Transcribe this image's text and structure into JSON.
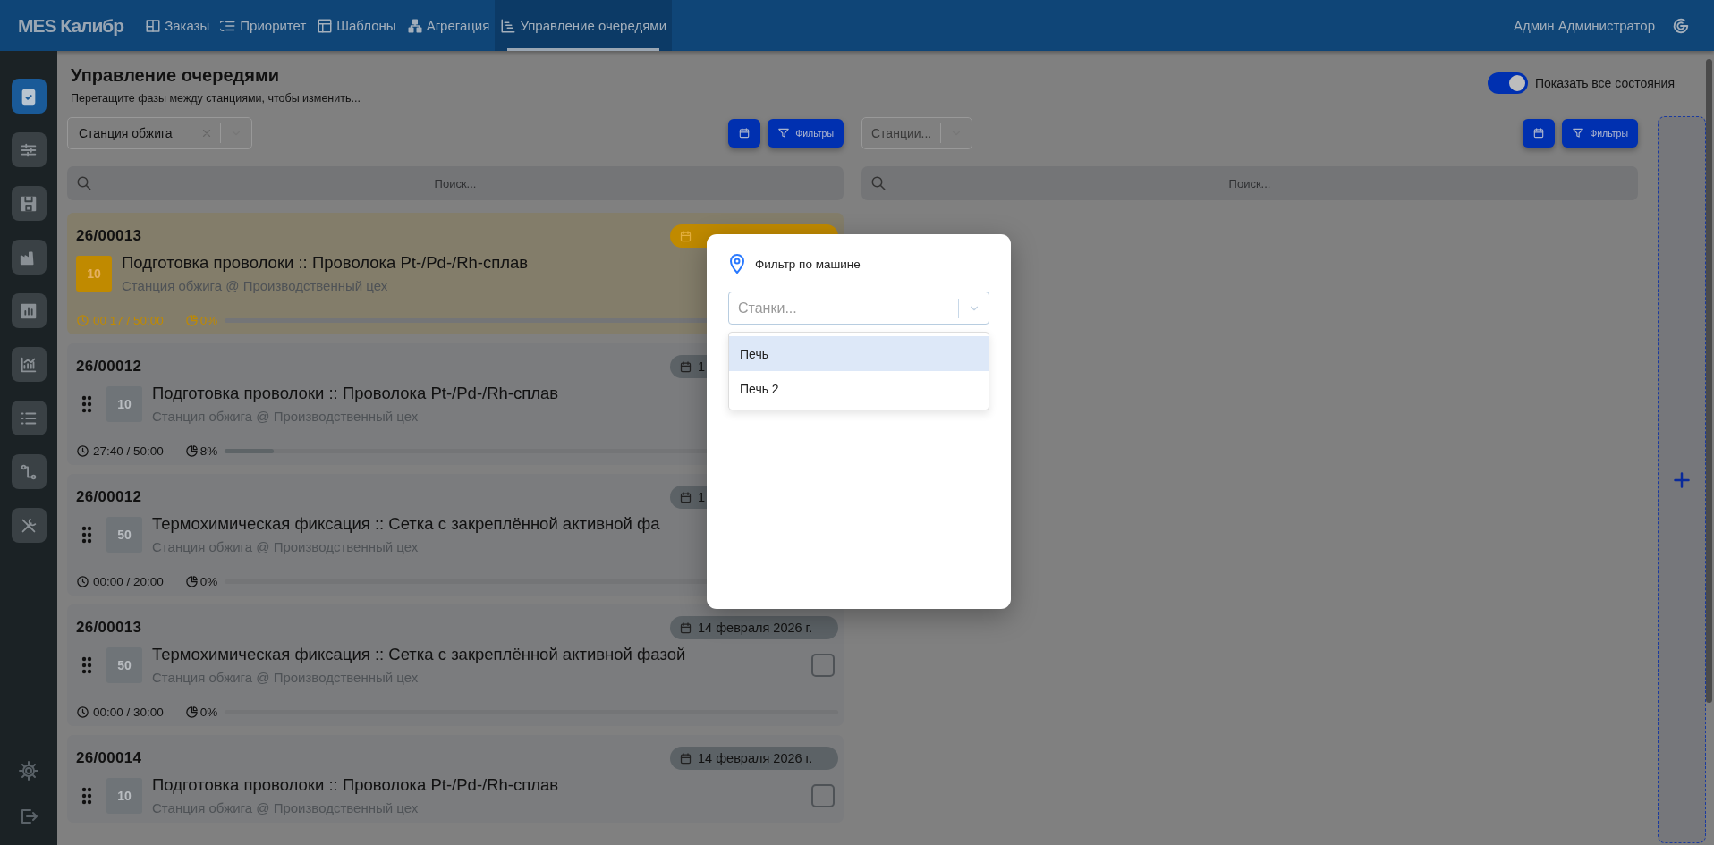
{
  "header": {
    "logo": "MES Калибр",
    "nav": [
      {
        "label": "Заказы",
        "selected": false
      },
      {
        "label": "Приоритет",
        "selected": false
      },
      {
        "label": "Шаблоны",
        "selected": false
      },
      {
        "label": "Агрегация",
        "selected": false
      },
      {
        "label": "Управление очередями",
        "selected": true
      }
    ],
    "user": "Админ Администратор"
  },
  "sidebar": {
    "items": [
      {
        "selected": true
      },
      {
        "selected": false
      },
      {
        "selected": false
      },
      {
        "selected": false
      },
      {
        "selected": false
      },
      {
        "selected": false
      },
      {
        "selected": false
      },
      {
        "selected": false
      },
      {
        "selected": false
      }
    ]
  },
  "page": {
    "title": "Управление очередями",
    "subtitle": "Перетащите фазы между станциями, чтобы изменить...",
    "toggle": {
      "label": "Показать все состояния",
      "on": true
    }
  },
  "columns": [
    {
      "station": {
        "value": "Станция обжига"
      },
      "filters_label": "Фильтры",
      "search_placeholder": "Поиск...",
      "cards": [
        {
          "order": "26/00013",
          "number": "10",
          "title": "Подготовка проволоки :: Проволока Pt-/Pd-/Rh-сплав",
          "location": "Станция обжига @ Производственный цех",
          "time": "00 17 / 50:00",
          "progress": "0%",
          "level": 0,
          "highlighted": true,
          "draggable": false
        },
        {
          "order": "26/00012",
          "date": "1",
          "number": "10",
          "title": "Подготовка проволоки :: Проволока Pt-/Pd-/Rh-сплав",
          "location": "Станция обжига @ Производственный цех",
          "time": "27:40 / 50:00",
          "progress": "8%",
          "level": 0.08,
          "highlighted": false,
          "draggable": true
        },
        {
          "order": "26/00012",
          "date": "1",
          "number": "50",
          "title": "Термохимическая фиксация :: Сетка с закреплённой активной фа",
          "location": "Станция обжига @ Производственный цех",
          "time": "00:00 / 20:00",
          "progress": "0%",
          "level": 0,
          "highlighted": false,
          "draggable": true
        },
        {
          "order": "26/00013",
          "date": "14 февраля 2026 г.",
          "number": "50",
          "title": "Термохимическая фиксация :: Сетка с закреплённой активной фазой",
          "location": "Станция обжига @ Производственный цех",
          "time": "00:00 / 30:00",
          "progress": "0%",
          "level": 0,
          "highlighted": false,
          "draggable": true,
          "checked": false
        },
        {
          "order": "26/00014",
          "date": "14 февраля 2026 г.",
          "number": "10",
          "title": "Подготовка проволоки :: Проволока Pt-/Pd-/Rh-сплав",
          "location": "Станция обжига @ Производственный цех",
          "highlighted": false,
          "draggable": true,
          "checked": false
        }
      ]
    },
    {
      "station": {
        "placeholder": "Станции..."
      },
      "filters_label": "Фильтры",
      "search_placeholder": "Поиск..."
    }
  ],
  "modal": {
    "title": "Фильтр по машине",
    "select_placeholder": "Станки...",
    "options": [
      {
        "label": "Печь",
        "selected": true
      },
      {
        "label": "Печь 2",
        "selected": false
      }
    ]
  }
}
